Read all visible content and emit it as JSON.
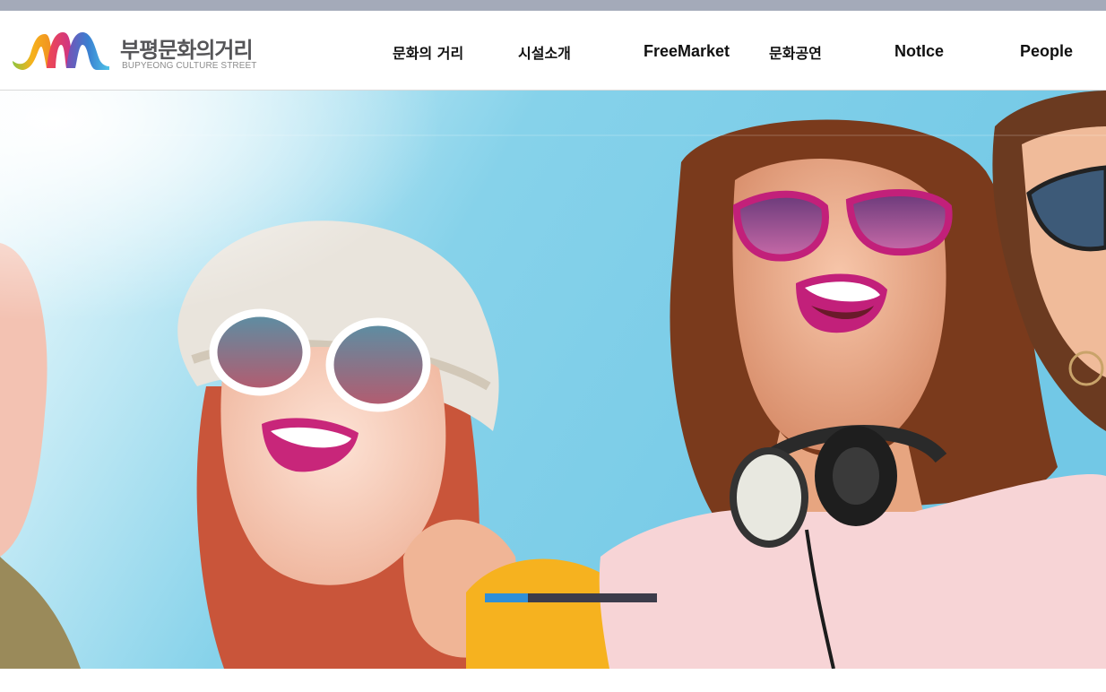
{
  "header": {
    "logo": {
      "title_ko": "부평문화의거리",
      "title_en": "BUPYEONG CULTURE STREET"
    },
    "nav": [
      {
        "label": "문화의 거리"
      },
      {
        "label": "시설소개"
      },
      {
        "label": "FreeMarket"
      },
      {
        "label": "문화공연"
      },
      {
        "label": "NotIce"
      },
      {
        "label": "People"
      }
    ]
  },
  "hero": {
    "image": "photo: group of laughing young women wearing sunglasses and headphones against a blue sky",
    "slider_progress": 0.25
  },
  "colors": {
    "top_bar": "#a4aab9",
    "progress_fill": "#2f8fd8",
    "progress_track": "#3c3c4a",
    "sky": "#7fcfe8"
  }
}
